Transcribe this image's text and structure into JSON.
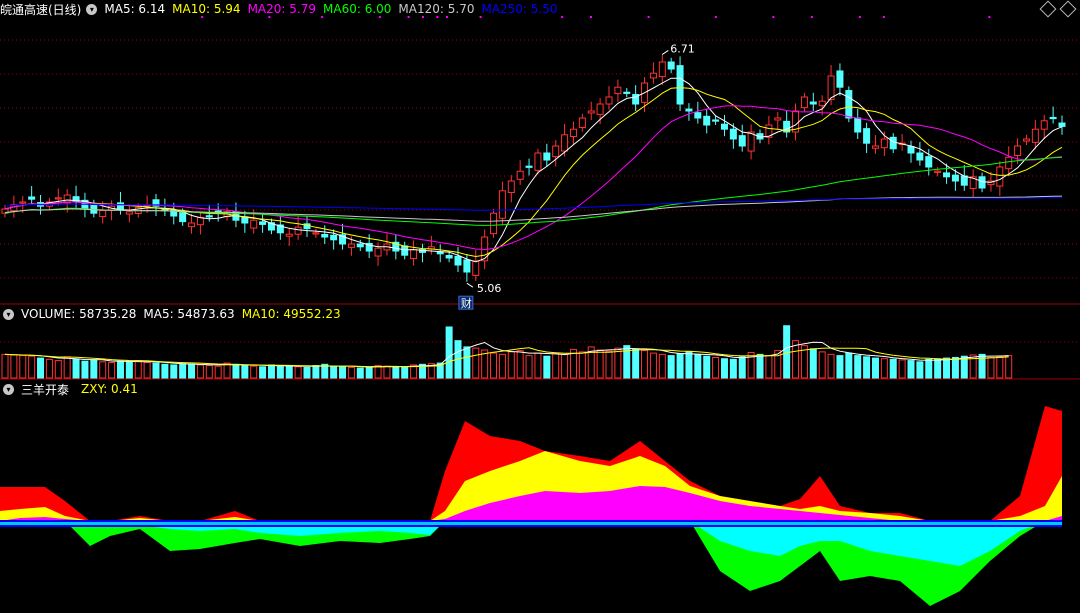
{
  "price_legend": {
    "title": "皖通高速(日线)",
    "items": [
      {
        "text": "MA5: 6.14",
        "color": "#ffffff"
      },
      {
        "text": "MA10: 5.94",
        "color": "#ffff00"
      },
      {
        "text": "MA20: 5.79",
        "color": "#ff00ff"
      },
      {
        "text": "MA60: 6.00",
        "color": "#00ff00"
      },
      {
        "text": "MA120: 5.70",
        "color": "#c8c8c8"
      },
      {
        "text": "MA250: 5.50",
        "color": "#0000ff"
      }
    ]
  },
  "volume_legend": {
    "items": [
      {
        "text": "VOLUME: 58735.28",
        "color": "#ffffff"
      },
      {
        "text": "MA5: 54873.63",
        "color": "#ffffff"
      },
      {
        "text": "MA10: 49552.23",
        "color": "#ffff00"
      }
    ]
  },
  "osc_legend": {
    "name": "三羊开泰",
    "items": [
      {
        "text": "ZXY: 0.41",
        "color": "#ffff00"
      }
    ]
  },
  "annotations": {
    "high": "6.71",
    "low": "5.06",
    "marker": "财"
  },
  "colors": {
    "up": "#ff3232",
    "down": "#54ffff",
    "grid": "#a00000",
    "bg": "#000000"
  },
  "chart_data": [
    {
      "type": "candlestick",
      "description_series": "price",
      "high_label": 6.71,
      "low_label": 5.06,
      "ylim": [
        4.9,
        6.9
      ],
      "closes": [
        5.55,
        5.58,
        5.6,
        5.62,
        5.57,
        5.6,
        5.63,
        5.65,
        5.6,
        5.55,
        5.52,
        5.54,
        5.57,
        5.55,
        5.53,
        5.56,
        5.58,
        5.57,
        5.54,
        5.5,
        5.46,
        5.45,
        5.49,
        5.5,
        5.52,
        5.53,
        5.47,
        5.45,
        5.47,
        5.44,
        5.4,
        5.38,
        5.37,
        5.42,
        5.41,
        5.38,
        5.35,
        5.33,
        5.3,
        5.3,
        5.28,
        5.25,
        5.27,
        5.3,
        5.25,
        5.22,
        5.26,
        5.24,
        5.28,
        5.23,
        5.2,
        5.15,
        5.1,
        5.18,
        5.35,
        5.52,
        5.68,
        5.75,
        5.82,
        5.85,
        5.95,
        5.9,
        6.0,
        6.08,
        6.12,
        6.2,
        6.25,
        6.3,
        6.35,
        6.42,
        6.38,
        6.3,
        6.45,
        6.52,
        6.6,
        6.55,
        6.3,
        6.25,
        6.2,
        6.15,
        6.18,
        6.12,
        6.05,
        6.0,
        6.1,
        6.05,
        6.15,
        6.2,
        6.1,
        6.25,
        6.35,
        6.3,
        6.32,
        6.5,
        6.42,
        6.2,
        6.1,
        6.02,
        6.0,
        6.05,
        5.98,
        6.02,
        5.95,
        5.9,
        5.85,
        5.82,
        5.78,
        5.75,
        5.72,
        5.78,
        5.7,
        5.75,
        5.85,
        5.92,
        6.0,
        6.05,
        6.12,
        6.18,
        6.2,
        6.14
      ]
    },
    {
      "type": "bar",
      "description_series": "volume",
      "values": [
        38,
        37,
        36,
        35,
        32,
        30,
        28,
        34,
        30,
        27,
        29,
        26,
        25,
        27,
        26,
        28,
        25,
        24,
        22,
        21,
        23,
        22,
        21,
        20,
        19,
        24,
        22,
        20,
        19,
        18,
        21,
        20,
        19,
        18,
        17,
        20,
        22,
        19,
        18,
        17,
        16,
        18,
        20,
        19,
        18,
        17,
        21,
        22,
        23,
        24,
        82,
        60,
        50,
        48,
        45,
        40,
        38,
        42,
        44,
        36,
        40,
        35,
        39,
        38,
        46,
        42,
        50,
        45,
        43,
        48,
        52,
        47,
        44,
        40,
        38,
        36,
        39,
        42,
        37,
        35,
        33,
        31,
        30,
        34,
        41,
        38,
        36,
        44,
        84,
        60,
        52,
        47,
        42,
        38,
        36,
        40,
        36,
        34,
        32,
        31,
        30,
        29,
        28,
        26,
        30,
        31,
        32,
        33,
        35,
        37,
        38,
        33,
        34,
        36
      ]
    },
    {
      "type": "area",
      "description_series": "三羊开泰 oscillator",
      "series": [
        {
          "name": "ZXY",
          "color": "#ffff00"
        }
      ],
      "ylim": [
        -1,
        1
      ]
    }
  ]
}
